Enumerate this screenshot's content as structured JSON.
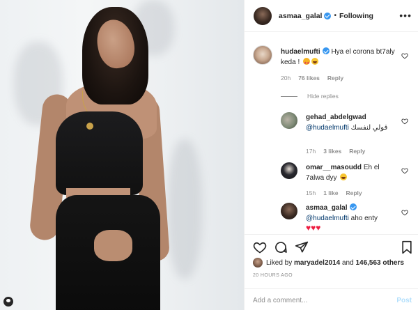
{
  "post": {
    "image_alt": "",
    "header": {
      "username": "asmaa_galal",
      "separator": "•",
      "follow_state": "Following",
      "more_icon": "more-horizontal-icon"
    },
    "comments": [
      {
        "username": "hudaelmufti",
        "verified": true,
        "text": "Hya el corona bt7aly keda !",
        "emojis": [
          "star-struck",
          "laughing"
        ],
        "time": "20h",
        "likes": "76 likes",
        "reply_label": "Reply",
        "hide_replies": "Hide replies",
        "replies": [
          {
            "username": "gehad_abdelgwad",
            "mention": "@hudaelmufti",
            "text": "قولي لنفسك",
            "time": "17h",
            "likes": "3 likes",
            "reply_label": "Reply"
          },
          {
            "username": "omar__masoudd",
            "text": "Eh el 7alwa dyy",
            "emojis": [
              "laughing"
            ],
            "time": "15h",
            "likes": "1 like",
            "reply_label": "Reply"
          },
          {
            "username": "asmaa_galal",
            "verified": true,
            "mention": "@hudaelmufti",
            "text": "aho enty",
            "hearts": "♥♥♥"
          }
        ]
      }
    ],
    "liked_by": {
      "prefix": "Liked by",
      "user": "maryadel2014",
      "middle": "and",
      "others": "146,563 others"
    },
    "timestamp": "20 HOURS AGO",
    "add_comment": {
      "placeholder": "Add a comment...",
      "post_label": "Post"
    },
    "colors": {
      "text": "#262626",
      "muted": "#8e8e8e",
      "link": "#00376b",
      "verified": "#3897f0",
      "post_disabled": "#b2dffc",
      "border": "#efefef"
    }
  }
}
